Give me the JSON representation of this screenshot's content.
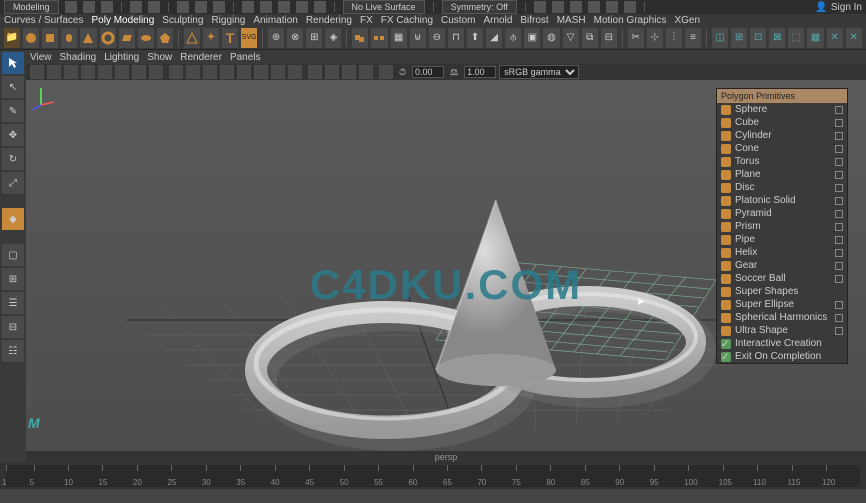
{
  "top": {
    "workspace": "Modeling",
    "surface": "No Live Surface",
    "symmetry": "Symmetry: Off",
    "signin": "Sign In"
  },
  "menu": {
    "items": [
      "Curves / Surfaces",
      "Poly Modeling",
      "Sculpting",
      "Rigging",
      "Animation",
      "Rendering",
      "FX",
      "FX Caching",
      "Custom",
      "Arnold",
      "Bifrost",
      "MASH",
      "Motion Graphics",
      "XGen"
    ]
  },
  "vmenu": {
    "items": [
      "View",
      "Shading",
      "Lighting",
      "Show",
      "Renderer",
      "Panels"
    ]
  },
  "vtool": {
    "time": "0.00",
    "scale": "1.00",
    "gamma": "sRGB gamma"
  },
  "viewport": {
    "label": "persp",
    "watermark": "C4DKU.COM"
  },
  "logo": "M",
  "prim": {
    "title": "Polygon Primitives",
    "items": [
      {
        "l": "Sphere",
        "b": true
      },
      {
        "l": "Cube",
        "b": true
      },
      {
        "l": "Cylinder",
        "b": true
      },
      {
        "l": "Cone",
        "b": true
      },
      {
        "l": "Torus",
        "b": true
      },
      {
        "l": "Plane",
        "b": true
      },
      {
        "l": "Disc",
        "b": true
      },
      {
        "l": "Platonic Solid",
        "b": true
      },
      {
        "l": "Pyramid",
        "b": true
      },
      {
        "l": "Prism",
        "b": true
      },
      {
        "l": "Pipe",
        "b": true
      },
      {
        "l": "Helix",
        "b": true
      },
      {
        "l": "Gear",
        "b": true
      },
      {
        "l": "Soccer Ball",
        "b": true
      },
      {
        "l": "Super Shapes",
        "b": false,
        "dis": true
      },
      {
        "l": "Super Ellipse",
        "b": true
      },
      {
        "l": "Spherical Harmonics",
        "b": true
      },
      {
        "l": "Ultra Shape",
        "b": true
      },
      {
        "l": "Interactive Creation",
        "chk": true
      },
      {
        "l": "Exit On Completion",
        "chk": true
      }
    ]
  },
  "timeline": {
    "ticks": [
      1,
      5,
      10,
      15,
      20,
      25,
      30,
      35,
      40,
      45,
      50,
      55,
      60,
      65,
      70,
      75,
      80,
      85,
      90,
      95,
      100,
      105,
      110,
      115,
      120
    ]
  }
}
